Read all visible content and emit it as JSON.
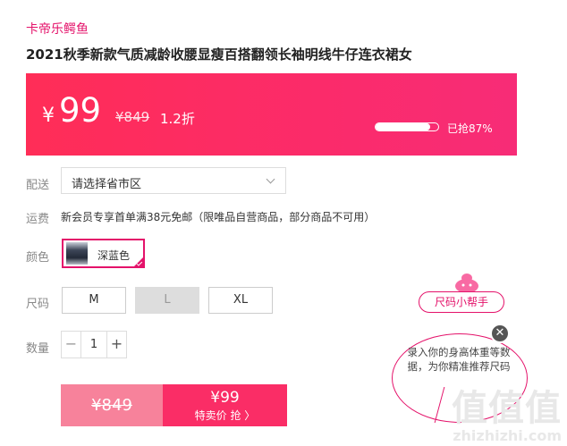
{
  "product": {
    "brand": "卡帝乐鳄鱼",
    "title": "2021秋季新款气质减龄收腰显瘦百搭翻领长袖明线牛仔连衣裙女"
  },
  "price_banner": {
    "currency": "¥",
    "price": "99",
    "original": "¥849",
    "discount": "1.2折",
    "sold_progress": 0.87,
    "sold_text": "已抢87%"
  },
  "delivery": {
    "label": "配送",
    "placeholder": "请选择省市区"
  },
  "shipping": {
    "label": "运费",
    "text": "新会员专享首单满38元免邮（限唯品自营商品，部分商品不可用）"
  },
  "color": {
    "label": "颜色",
    "options": [
      {
        "name": "深蓝色",
        "selected": true
      }
    ]
  },
  "size": {
    "label": "尺码",
    "options": [
      {
        "name": "M",
        "available": true
      },
      {
        "name": "L",
        "available": false
      },
      {
        "name": "XL",
        "available": true
      }
    ]
  },
  "quantity": {
    "label": "数量",
    "minus": "−",
    "value": "1",
    "plus": "+"
  },
  "buy": {
    "original_price": "¥849",
    "special_price": "¥99",
    "special_label": "特卖价 抢 〉"
  },
  "size_helper": {
    "title": "尺码小帮手",
    "bubble_text": "录入你的身高体重等数据，为你精准推荐尺码",
    "close": "✕"
  },
  "watermark": {
    "big": "值值值",
    "small": "zhizhizhi.com"
  },
  "colors": {
    "accent": "#e4126a",
    "banner": "#fb2b6a",
    "buy_left": "#f7829b",
    "buy_right": "#fa2d66"
  }
}
